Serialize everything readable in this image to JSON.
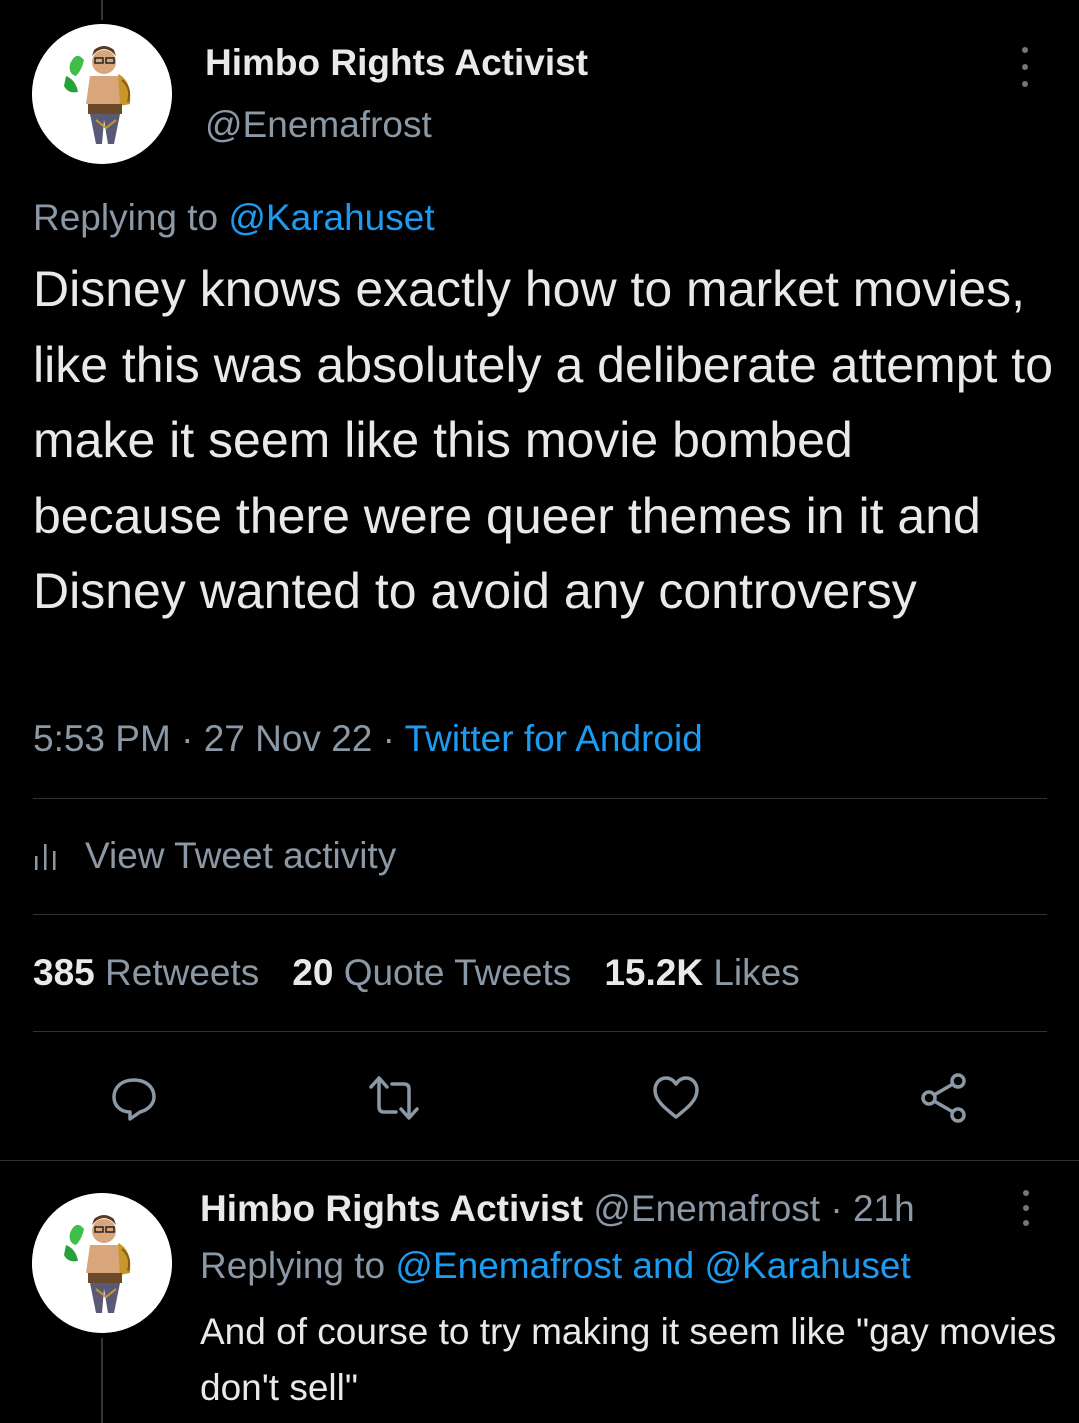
{
  "main_tweet": {
    "author_name": "Himbo Rights Activist",
    "author_handle": "@Enemafrost",
    "replying_prefix": "Replying to ",
    "replying_to": "@Karahuset",
    "text": "Disney knows exactly how to market movies, like this was absolutely a deliberate attempt to make it seem like this movie bombed because there were queer themes in it and Disney wanted to avoid any controversy",
    "time": "5:53 PM",
    "date": "27 Nov 22",
    "source": "Twitter for Android",
    "separator": " · "
  },
  "activity": {
    "label": "View Tweet activity"
  },
  "stats": {
    "retweets_count": "385",
    "retweets_label": "Retweets",
    "quotes_count": "20",
    "quotes_label": "Quote Tweets",
    "likes_count": "15.2K",
    "likes_label": "Likes"
  },
  "actions": {
    "reply_icon": "reply-icon",
    "retweet_icon": "retweet-icon",
    "like_icon": "heart-icon",
    "share_icon": "share-icon"
  },
  "reply_tweet": {
    "author_name": "Himbo Rights Activist",
    "author_handle": "@Enemafrost",
    "age": "21h",
    "separator": " · ",
    "replying_prefix": "Replying to ",
    "replying_to_1": "@Enemafrost",
    "and_word": " and ",
    "replying_to_2": "@Karahuset",
    "text": "And of course to try making it seem like \"gay movies don't sell\""
  },
  "colors": {
    "background": "#000000",
    "text_primary": "#e7e9ea",
    "text_secondary": "#8b98a5",
    "link": "#1d9bf0",
    "divider": "#2f3336"
  }
}
